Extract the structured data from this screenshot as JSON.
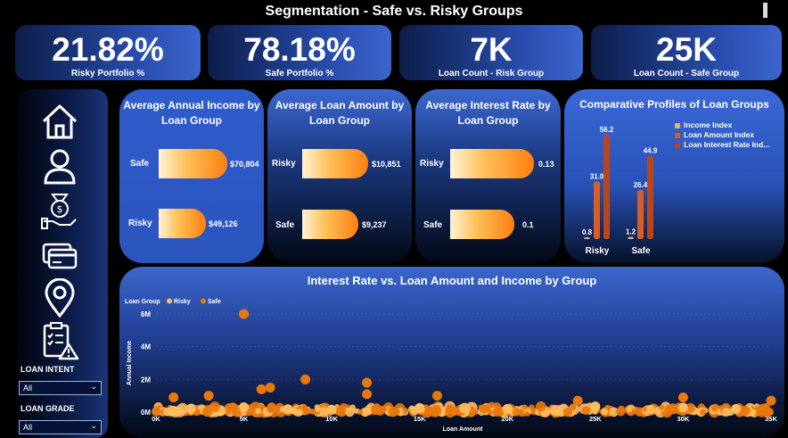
{
  "page": {
    "title": "Segmentation - Safe vs. Risky Groups"
  },
  "kpis": [
    {
      "value": "21.82%",
      "label": "Risky Portfolio %"
    },
    {
      "value": "78.18%",
      "label": "Safe Portfolio %"
    },
    {
      "value": "7K",
      "label": "Loan Count - Risk Group"
    },
    {
      "value": "25K",
      "label": "Loan Count - Safe Group"
    }
  ],
  "sidebar": {
    "icons": [
      "home-icon",
      "user-icon",
      "money-hand-icon",
      "credit-cards-icon",
      "location-pin-icon",
      "checklist-warning-icon"
    ],
    "filters": [
      {
        "label": "LOAN INTENT",
        "value": "All"
      },
      {
        "label": "LOAN GRADE",
        "value": "All"
      }
    ]
  },
  "cards": {
    "income": {
      "title": "Average Annual Income by Loan Group",
      "bars": [
        {
          "label": "Safe",
          "value": "$70,804",
          "fraction": 1.0
        },
        {
          "label": "Risky",
          "value": "$49,126",
          "fraction": 0.694
        }
      ]
    },
    "loan_amount": {
      "title": "Average Loan Amount by Loan Group",
      "bars": [
        {
          "label": "Risky",
          "value": "$10,851",
          "fraction": 1.0
        },
        {
          "label": "Safe",
          "value": "$9,237",
          "fraction": 0.851
        }
      ]
    },
    "interest": {
      "title": "Average Interest Rate by Loan Group",
      "bars": [
        {
          "label": "Risky",
          "value": "0.13",
          "fraction": 1.0
        },
        {
          "label": "Safe",
          "value": "0.1",
          "fraction": 0.77
        }
      ]
    }
  },
  "compare": {
    "title": "Comparative Profiles of Loan Groups",
    "legend": [
      "Income Index",
      "Loan Amount Index",
      "Loan Interest Rate Ind..."
    ],
    "colors": [
      "#e0a883",
      "#d65f25",
      "#b8461c"
    ]
  },
  "scatter": {
    "title": "Interest Rate vs. Loan Amount and Income by Group",
    "legend_title": "Loan Group",
    "legend": [
      "Risky",
      "Safe"
    ],
    "colors": {
      "Risky": "#ffbd5e",
      "Safe": "#e8780d"
    },
    "xlabel": "Loan Amount",
    "ylabel": "Annual Income"
  },
  "chart_data": [
    {
      "type": "bar",
      "title": "Comparative Profiles of Loan Groups",
      "categories": [
        "Risky",
        "Safe"
      ],
      "series": [
        {
          "name": "Income Index",
          "values": [
            0.8,
            1.2
          ]
        },
        {
          "name": "Loan Amount Index",
          "values": [
            31.0,
            26.4
          ]
        },
        {
          "name": "Loan Interest Rate Ind...",
          "values": [
            56.2,
            44.9
          ]
        }
      ],
      "ylim": [
        0,
        60
      ]
    },
    {
      "type": "scatter",
      "title": "Interest Rate vs. Loan Amount and Income by Group",
      "xlabel": "Loan Amount",
      "ylabel": "Annual Income",
      "xlim": [
        0,
        35000
      ],
      "ylim": [
        0,
        6000000
      ],
      "xticks": [
        "0K",
        "5K",
        "10K",
        "15K",
        "20K",
        "25K",
        "30K",
        "35K"
      ],
      "yticks": [
        "0M",
        "2M",
        "4M",
        "6M"
      ],
      "series": [
        {
          "name": "Risky",
          "points": [
            [
              2000,
              220000
            ],
            [
              5000,
              300000
            ],
            [
              7500,
              180000
            ],
            [
              10000,
              150000
            ],
            [
              15000,
              250000
            ],
            [
              20000,
              200000
            ],
            [
              25000,
              350000
            ],
            [
              30000,
              280000
            ],
            [
              33000,
              190000
            ]
          ]
        },
        {
          "name": "Safe",
          "points": [
            [
              5000,
              6000000
            ],
            [
              8500,
              2000000
            ],
            [
              12000,
              1800000
            ],
            [
              12000,
              1100000
            ],
            [
              6500,
              1500000
            ],
            [
              6000,
              1400000
            ],
            [
              3000,
              1000000
            ],
            [
              16000,
              1000000
            ],
            [
              1000,
              900000
            ],
            [
              30000,
              900000
            ],
            [
              35000,
              700000
            ],
            [
              24000,
              700000
            ]
          ]
        }
      ]
    }
  ]
}
